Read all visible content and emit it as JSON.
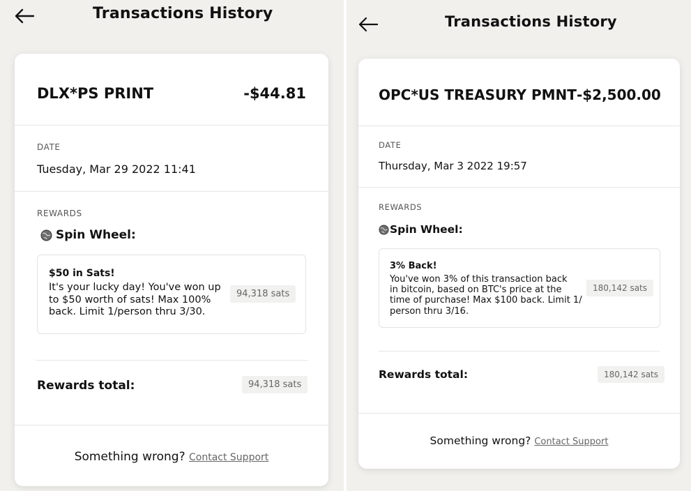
{
  "screens": [
    {
      "header": {
        "title": "Transactions History"
      },
      "transaction": {
        "merchant": "DLX*PS PRINT",
        "amount": "-$44.81",
        "date_label": "DATE",
        "date_value": "Tuesday, Mar 29 2022 11:41"
      },
      "rewards": {
        "section_label": "REWARDS",
        "spin_label": "Spin Wheel:",
        "offer_title": "$50 in Sats!",
        "offer_desc_lines": [
          "It's your lucky day! You've won up",
          "to $50 worth of sats! Max 100%",
          "back. Limit 1/person thru 3/30."
        ],
        "offer_sats": "94,318 sats",
        "total_label": "Rewards total:",
        "total_sats": "94,318 sats"
      },
      "footer": {
        "question": "Something wrong?",
        "link": "Contact Support"
      }
    },
    {
      "header": {
        "title": "Transactions History"
      },
      "transaction": {
        "merchant": "OPC*US TREASURY PMNT",
        "amount": "-$2,500.00",
        "date_label": "DATE",
        "date_value": "Thursday, Mar 3 2022 19:57"
      },
      "rewards": {
        "section_label": "REWARDS",
        "spin_label": "Spin Wheel:",
        "offer_title": "3% Back!",
        "offer_desc_lines": [
          "You've won 3% of this transaction back",
          "in bitcoin, based on BTC's price at the",
          "time of purchase! Max $100 back. Limit 1/",
          "person thru 3/16."
        ],
        "offer_sats": "180,142 sats",
        "total_label": "Rewards total:",
        "total_sats": "180,142 sats"
      },
      "footer": {
        "question": "Something wrong?",
        "link": "Contact Support"
      }
    }
  ],
  "icons": {
    "back": "arrow-left-icon",
    "globe": "globe-icon"
  },
  "colors": {
    "card_bg": "#ffffff",
    "page_bg": "#f1f0ed",
    "badge_bg": "#f1f1f0",
    "text": "#111111",
    "muted": "#555555"
  }
}
